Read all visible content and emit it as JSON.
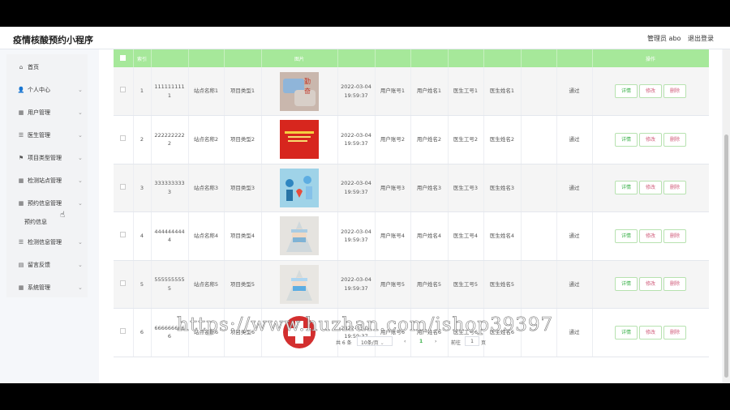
{
  "header": {
    "title": "疫情核酸预约小程序",
    "admin": "管理员 abo",
    "logout": "退出登录"
  },
  "sidebar": {
    "items": [
      {
        "label": "首页",
        "icon": "home-icon",
        "glyph": "⌂",
        "chev": false
      },
      {
        "label": "个人中心",
        "icon": "user-icon",
        "glyph": "👤",
        "chev": true
      },
      {
        "label": "用户管理",
        "icon": "grid-icon",
        "glyph": "▦",
        "chev": true
      },
      {
        "label": "医生管理",
        "icon": "list-icon",
        "glyph": "☰",
        "chev": true
      },
      {
        "label": "项目类型管理",
        "icon": "flag-icon",
        "glyph": "⚑",
        "chev": true
      },
      {
        "label": "检测站点管理",
        "icon": "grid-icon",
        "glyph": "▦",
        "chev": true
      },
      {
        "label": "预约信息管理",
        "icon": "grid-icon",
        "glyph": "▦",
        "chev": true
      }
    ],
    "sub_item": "预约信息",
    "items2": [
      {
        "label": "检测信息管理",
        "icon": "list-icon",
        "glyph": "☰",
        "chev": true
      },
      {
        "label": "留言反馈",
        "icon": "message-icon",
        "glyph": "▤",
        "chev": true
      },
      {
        "label": "系统管理",
        "icon": "grid-icon",
        "glyph": "▦",
        "chev": true
      }
    ]
  },
  "table": {
    "headers": [
      "",
      "索引",
      "",
      "",
      "",
      "图片",
      "",
      "",
      "",
      "",
      "",
      "",
      "",
      "操作"
    ],
    "rows": [
      {
        "index": "1",
        "no": "1111111111",
        "site": "站点名称1",
        "type": "项目类型1",
        "time": "2022-03-04 19:59:37",
        "account": "用户账号1",
        "name": "用户姓名1",
        "doc_no": "医生工号1",
        "doc_name": "医生姓名1",
        "status": "通过"
      },
      {
        "index": "2",
        "no": "2222222222",
        "site": "站点名称2",
        "type": "项目类型2",
        "time": "2022-03-04 19:59:37",
        "account": "用户账号2",
        "name": "用户姓名2",
        "doc_no": "医生工号2",
        "doc_name": "医生姓名2",
        "status": "通过"
      },
      {
        "index": "3",
        "no": "3333333333",
        "site": "站点名称3",
        "type": "项目类型3",
        "time": "2022-03-04 19:59:37",
        "account": "用户账号3",
        "name": "用户姓名3",
        "doc_no": "医生工号3",
        "doc_name": "医生姓名3",
        "status": "通过"
      },
      {
        "index": "4",
        "no": "4444444444",
        "site": "站点名称4",
        "type": "项目类型4",
        "time": "2022-03-04 19:59:37",
        "account": "用户账号4",
        "name": "用户姓名4",
        "doc_no": "医生工号4",
        "doc_name": "医生姓名4",
        "status": "通过"
      },
      {
        "index": "5",
        "no": "5555555555",
        "site": "站点名称5",
        "type": "项目类型5",
        "time": "2022-03-04 19:59:37",
        "account": "用户账号5",
        "name": "用户姓名5",
        "doc_no": "医生工号5",
        "doc_name": "医生姓名5",
        "status": "通过"
      },
      {
        "index": "6",
        "no": "6666666666",
        "site": "站点名称6",
        "type": "项目类型6",
        "time": "2022-03-04 19:59:37",
        "account": "用户账号6",
        "name": "用户姓名6",
        "doc_no": "医生工号6",
        "doc_name": "医生姓名6",
        "status": "通过"
      }
    ],
    "actions": {
      "detail": "详情",
      "edit": "修改",
      "delete": "删除"
    }
  },
  "pager": {
    "total": "共 6 条",
    "size": "10条/页",
    "prev": "‹",
    "current": "1",
    "next": "›",
    "goto": "前往",
    "page": "1",
    "suffix": "页"
  },
  "watermark": "https://www.huzhan.com/ishop39397",
  "colors": {
    "header_green": "#a6e89a",
    "accent": "#3bb14a",
    "danger": "#d05b7a"
  }
}
